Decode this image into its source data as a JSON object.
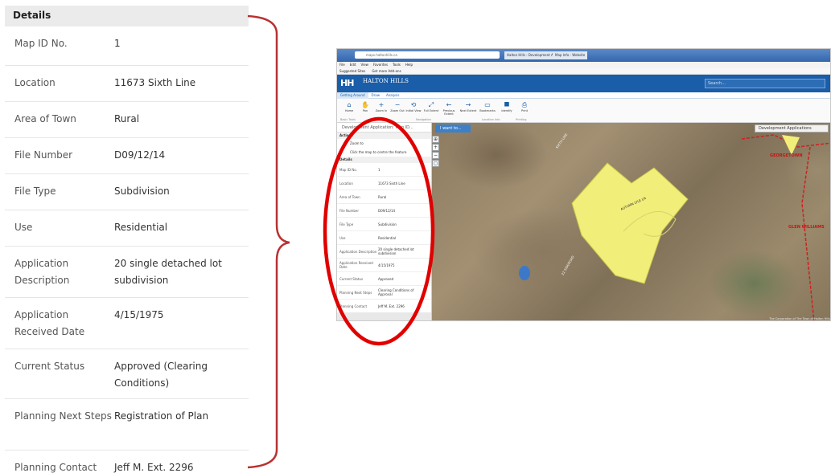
{
  "details": {
    "header": "Details",
    "rows": [
      {
        "label": "Map ID No.",
        "value": "1"
      },
      {
        "label": "Location",
        "value": "11673 Sixth Line"
      },
      {
        "label": "Area of Town",
        "value": "Rural"
      },
      {
        "label": "File Number",
        "value": "D09/12/14"
      },
      {
        "label": "File Type",
        "value": "Subdivision"
      },
      {
        "label": "Use",
        "value": "Residential"
      },
      {
        "label": "Application Description",
        "value": "20 single detached lot subdivision"
      },
      {
        "label": "Application Received Date",
        "value": "4/15/1975"
      },
      {
        "label": "Current Status",
        "value": "Approved (Clearing Conditions)"
      },
      {
        "label": "Planning Next Steps",
        "value": "Registration of Plan"
      },
      {
        "label": "Planning Contact",
        "value": "Jeff M. Ext. 2296"
      }
    ]
  },
  "browser": {
    "address": "maps.haltonhills.ca",
    "tab1": "Halton Hills - Development Ap...",
    "tab2": "Map Info - Website",
    "menu": [
      "File",
      "Edit",
      "View",
      "Favorites",
      "Tools",
      "Help"
    ],
    "favorites": [
      "Suggested Sites",
      "Get more Add-ons"
    ]
  },
  "site": {
    "logo": "HH",
    "name": "HALTON HILLS",
    "search_placeholder": "Search...",
    "tabs": [
      "Getting Around",
      "Draw",
      "Analysis"
    ],
    "tools": [
      "Home",
      "Pan",
      "Zoom In",
      "Zoom Out",
      "Initial View",
      "Full Extent",
      "Previous Extent",
      "Next Extent",
      "Bookmarks",
      "Identify",
      "Print"
    ],
    "tool_groups": [
      "Basic Tools",
      "Navigation",
      "Location Info",
      "Printing"
    ]
  },
  "side": {
    "title": "Development Application: Map ID...",
    "actions_header": "Actions",
    "action_zoom": "Zoom to",
    "action_hint": "Click the map to centre the feature",
    "details_header": "Details",
    "rows": [
      {
        "l": "Map ID No.",
        "v": "1"
      },
      {
        "l": "Location",
        "v": "11673 Sixth Line"
      },
      {
        "l": "Area of Town",
        "v": "Rural"
      },
      {
        "l": "File Number",
        "v": "D09/12/14"
      },
      {
        "l": "File Type",
        "v": "Subdivision"
      },
      {
        "l": "Use",
        "v": "Residential"
      },
      {
        "l": "Application Description",
        "v": "20 single detached lot subdivision"
      },
      {
        "l": "Application Received Date",
        "v": "4/15/1975"
      },
      {
        "l": "Current Status",
        "v": "Approved"
      },
      {
        "l": "Planning Next Steps",
        "v": "Clearing Conditions of Approval"
      },
      {
        "l": "Planning Contact",
        "v": "Jeff M. Ext. 2296"
      }
    ]
  },
  "map": {
    "i_want_to": "I want to...",
    "layer_dropdown": "Development Applications",
    "road_autumn": "AUTUMN LYLE LN",
    "road_1": "SIXTH LINE",
    "road_2": "22 SIDEROAD",
    "town_1": "GEORGETOWN",
    "town_2": "GLEN WILLIAMS",
    "attribution": "The Corporation of The Town of Halton Hills"
  },
  "colors": {
    "brace": "#b83232",
    "ellipse": "#e00000",
    "parcel": "#f2ee7a",
    "header_blue": "#1a5da8"
  }
}
